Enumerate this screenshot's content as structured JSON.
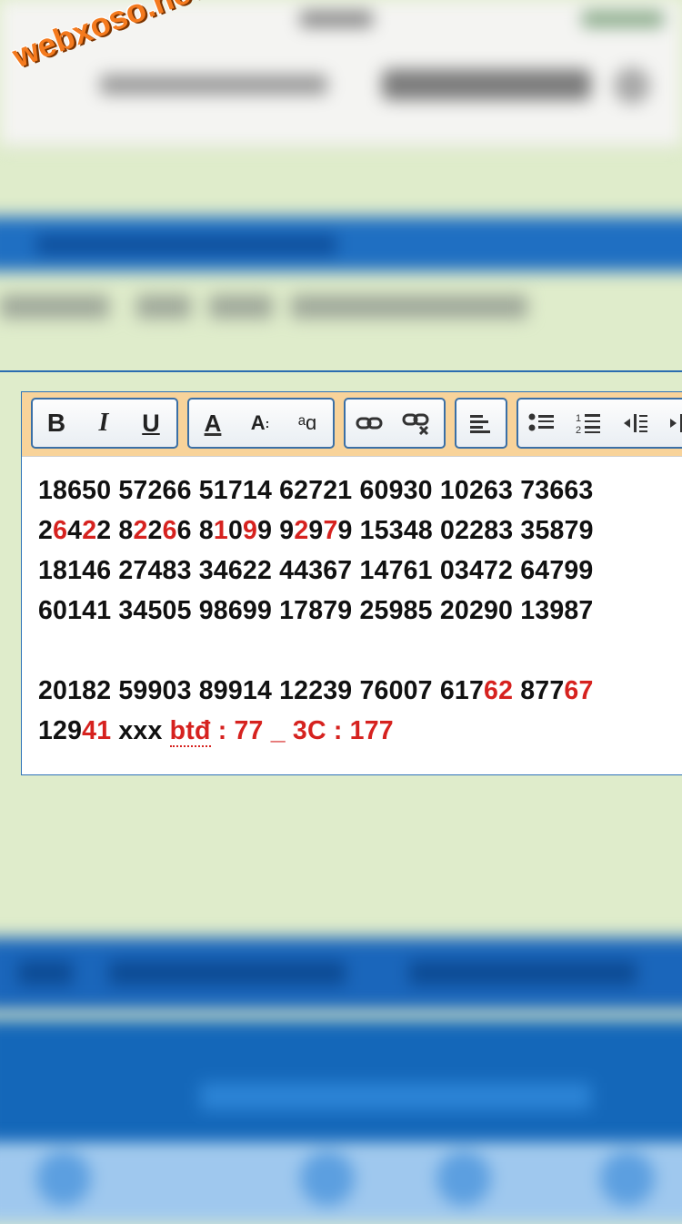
{
  "watermark": "webxoso.net",
  "toolbar": {
    "bold": "B",
    "italic": "I",
    "underline": "U",
    "font_color": "A",
    "font_size": "A",
    "font_size_sub": ":",
    "font_family": "ᵃɑ",
    "link": "🔗",
    "unlink": "🔗",
    "align_left": "≡",
    "bullets": "•☰",
    "numbers": "1☰",
    "outdent": "⇤",
    "indent": "⇥",
    "colors": {
      "group_border": "#3a6fa6",
      "bar_bg": "#f8d39a"
    }
  },
  "content": {
    "lines": [
      [
        {
          "t": "18650 57266 51714 62721 60930 10263 73663"
        }
      ],
      [
        {
          "t": "2"
        },
        {
          "t": "6",
          "red": true
        },
        {
          "t": "4"
        },
        {
          "t": "2",
          "red": true
        },
        {
          "t": "2 8"
        },
        {
          "t": "2",
          "red": true
        },
        {
          "t": "2"
        },
        {
          "t": "6",
          "red": true
        },
        {
          "t": "6 8"
        },
        {
          "t": "1",
          "red": true
        },
        {
          "t": "0"
        },
        {
          "t": "9",
          "red": true
        },
        {
          "t": "9 9"
        },
        {
          "t": "2",
          "red": true
        },
        {
          "t": "9"
        },
        {
          "t": "7",
          "red": true
        },
        {
          "t": "9 15348 02283 35879"
        }
      ],
      [
        {
          "t": "18146 27483 34622 44367 14761 03472 64799"
        }
      ],
      [
        {
          "t": "60141 34505 98699 17879 25985 20290 13987"
        }
      ],
      [
        {
          "t": " "
        }
      ],
      [
        {
          "t": "20182 59903 89914 12239 76007 617"
        },
        {
          "t": "62",
          "red": true
        },
        {
          "t": " 877"
        },
        {
          "t": "67",
          "red": true
        }
      ],
      [
        {
          "t": "129"
        },
        {
          "t": "41",
          "red": true
        },
        {
          "t": " xxx "
        },
        {
          "t": "btđ",
          "red": true,
          "ul": true
        },
        {
          "t": " : 77 _ 3C : 177",
          "red": true
        }
      ]
    ],
    "colors": {
      "text": "#111111",
      "highlight": "#d6221f"
    }
  }
}
